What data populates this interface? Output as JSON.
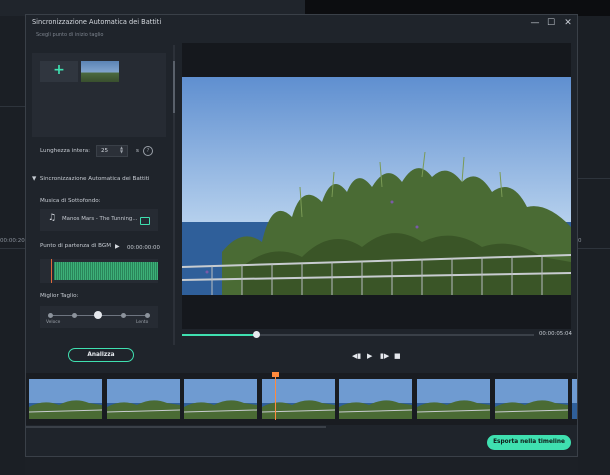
{
  "dialog": {
    "title": "Sincronizzazione Automatica dei Battiti",
    "minimize_glyph": "—",
    "maximize_glyph": "☐",
    "close_glyph": "✕"
  },
  "background": {
    "timecode_left": "00:00:20:0",
    "timecode_right": "0"
  },
  "left_panel": {
    "cut_label": "Scegli punto di inizio taglio",
    "add_glyph": "+",
    "length_label": "Lunghezza intera:",
    "length_value": "25",
    "length_unit": "s",
    "help_glyph": "?",
    "section_title": "Sincronizzazione Automatica dei Battiti",
    "music_label": "Musica di Sottofondo:",
    "music_name": "Manos Mars - The Tunning...",
    "bgm_label": "Punto di partenza di BGM",
    "bgm_time": "00:00:00:00",
    "best_cut_label": "Miglior Taglio:",
    "slider_min_label": "Veloce",
    "slider_max_label": "Lento",
    "slider_level": 0.5,
    "analyze_button": "Analizza"
  },
  "preview": {
    "progress": 0.21,
    "time": "00:00:05:04"
  },
  "footer": {
    "export_button": "Esporta nella timeline"
  },
  "colors": {
    "accent": "#3fe0b0",
    "playhead": "#ff8a3d",
    "dialog_bg": "#1f242b"
  }
}
